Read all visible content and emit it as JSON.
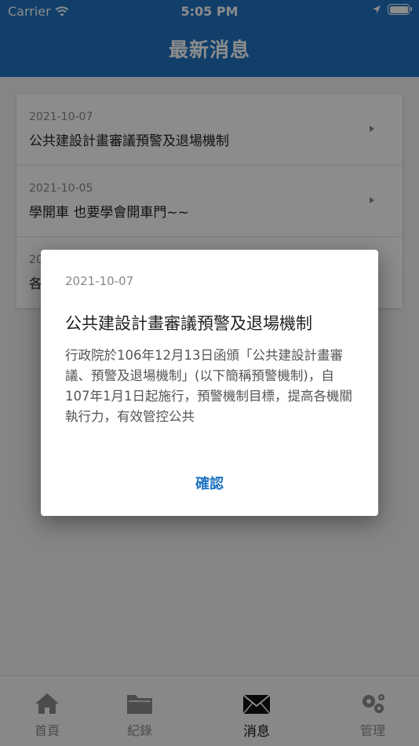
{
  "status_bar": {
    "carrier": "Carrier",
    "time": "5:05 PM"
  },
  "header": {
    "title": "最新消息"
  },
  "news": [
    {
      "date": "2021-10-07",
      "title": "公共建設計畫審議預警及退場機制"
    },
    {
      "date": "2021-10-05",
      "title": "學開車 也要學會開車門~~"
    },
    {
      "date": "20",
      "title": "各"
    }
  ],
  "dialog": {
    "date": "2021-10-07",
    "title": "公共建設計畫審議預警及退場機制",
    "body": "行政院於106年12月13日函頒「公共建設計畫審議、預警及退場機制」(以下簡稱預警機制)，自107年1月1日起施行，預警機制目標，提高各機關執行力，有效管控公共",
    "confirm_label": "確認"
  },
  "tabs": [
    {
      "label": "首頁",
      "icon": "home-icon"
    },
    {
      "label": "紀錄",
      "icon": "folder-icon"
    },
    {
      "label": "消息",
      "icon": "mail-icon",
      "active": true
    },
    {
      "label": "管理",
      "icon": "gear-icon"
    }
  ],
  "colors": {
    "primary": "#1f74c2",
    "overlay": "rgba(0,0,0,0.45)"
  }
}
